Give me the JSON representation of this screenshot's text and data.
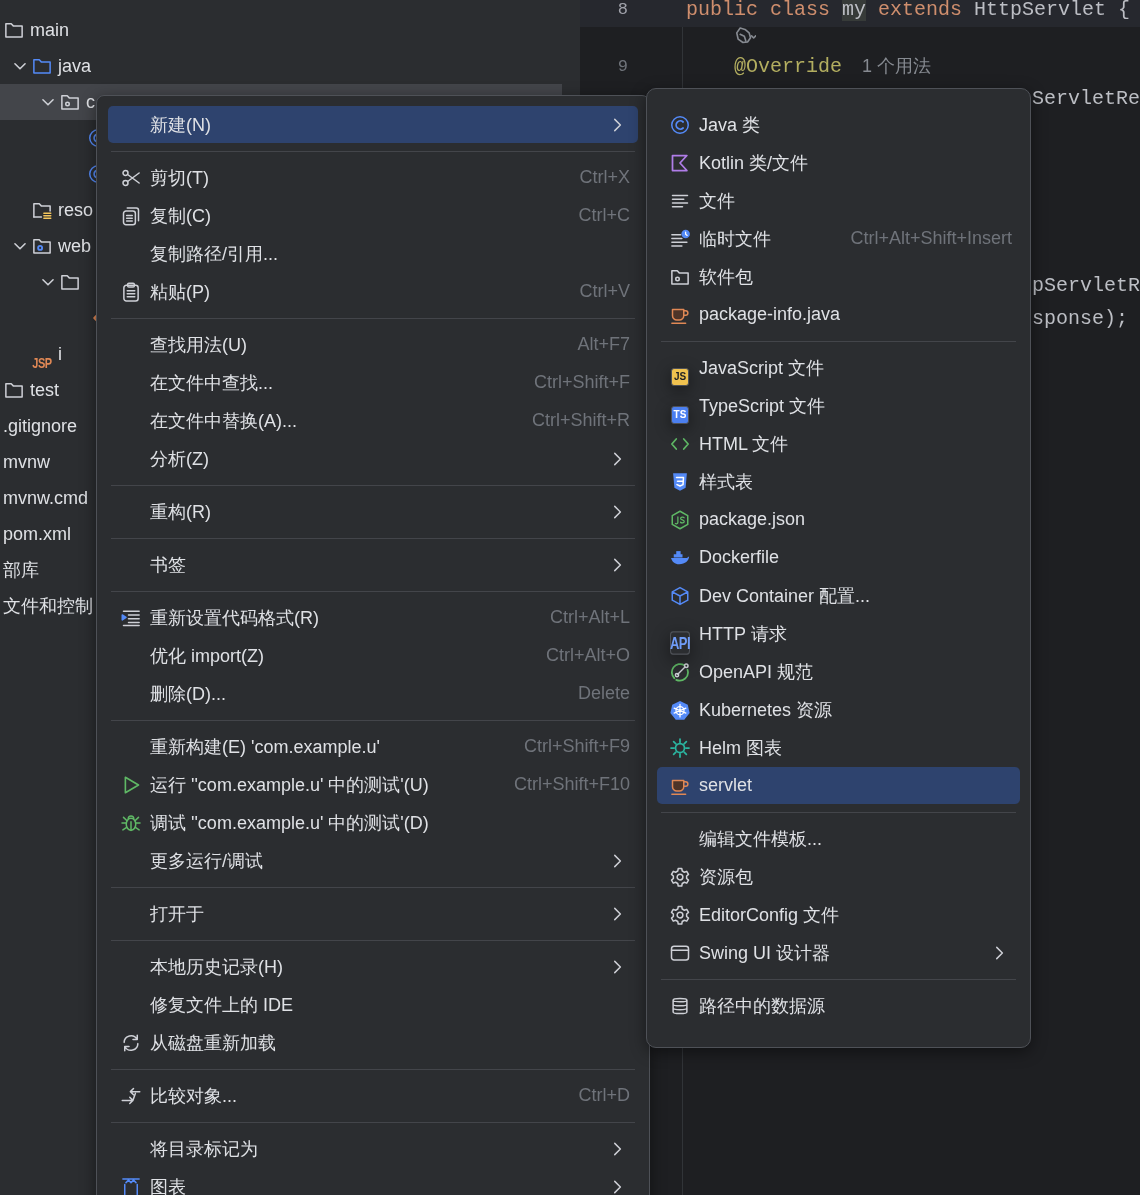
{
  "project_tree": [
    {
      "label": "main",
      "kind": "folder",
      "selected": false,
      "children": [
        {
          "label": "java",
          "kind": "source_folder",
          "expanded": true,
          "selected": false,
          "children": [
            {
              "label": "c",
              "kind": "package",
              "expanded": true,
              "selected": true,
              "children": [
                {
                  "kind": "class",
                  "selected": false
                },
                {
                  "kind": "class",
                  "selected": false
                }
              ]
            }
          ]
        },
        {
          "label": "reso",
          "kind": "resources_folder",
          "selected": false
        },
        {
          "label": "web",
          "kind": "web_folder",
          "expanded": true,
          "selected": false,
          "children": [
            {
              "kind": "folder",
              "expanded": true,
              "selected": false,
              "children": [
                {
                  "kind": "xml",
                  "selected": false
                }
              ]
            },
            {
              "label": "i",
              "kind": "badge",
              "badge": "JSP",
              "selected": false
            }
          ]
        }
      ]
    },
    {
      "label": "test",
      "kind": "folder",
      "selected": false
    },
    {
      "label": ".gitignore",
      "kind": "file",
      "selected": false
    },
    {
      "label": "mvnw",
      "kind": "file",
      "selected": false
    },
    {
      "label": "mvnw.cmd",
      "kind": "file",
      "selected": false
    },
    {
      "label": "pom.xml",
      "kind": "file",
      "selected": false
    },
    {
      "label": "部库",
      "kind": "file",
      "selected": false
    },
    {
      "label": "文件和控制",
      "kind": "file",
      "selected": false
    }
  ],
  "editor": {
    "lines": [
      {
        "kind": "code",
        "number": "8",
        "current": true,
        "tokens": [
          {
            "kind": "keyword",
            "text": "public class "
          },
          {
            "kind": "highlight",
            "text": "my"
          },
          {
            "kind": "keyword",
            "text": " extends "
          },
          {
            "kind": "plain",
            "text": "HttpServlet {"
          }
        ]
      },
      {
        "kind": "inlay"
      },
      {
        "kind": "code",
        "number": "9",
        "current": false,
        "tokens": [
          {
            "kind": "annotation",
            "text": "    @Override"
          },
          {
            "kind": "hint",
            "text": "1 个用法"
          }
        ]
      },
      {
        "kind": "fragment",
        "text": "ServletRe"
      },
      {
        "kind": "fragment",
        "text": "pServletR"
      },
      {
        "kind": "fragment",
        "text": "sponse);"
      }
    ]
  },
  "context_menu": {
    "items": [
      {
        "kind": "plain",
        "label": "新建(N)",
        "has_submenu": true,
        "selected": true
      },
      {
        "kind": "separator"
      },
      {
        "kind": "scissors",
        "label": "剪切(T)",
        "shortcut": "Ctrl+X",
        "has_submenu": false,
        "selected": false
      },
      {
        "kind": "copy",
        "label": "复制(C)",
        "shortcut": "Ctrl+C",
        "has_submenu": false,
        "selected": false
      },
      {
        "kind": "plain",
        "label": "复制路径/引用...",
        "has_submenu": false,
        "selected": false
      },
      {
        "kind": "paste",
        "label": "粘贴(P)",
        "shortcut": "Ctrl+V",
        "has_submenu": false,
        "selected": false
      },
      {
        "kind": "separator"
      },
      {
        "kind": "plain",
        "label": "查找用法(U)",
        "shortcut": "Alt+F7",
        "has_submenu": false,
        "selected": false
      },
      {
        "kind": "plain",
        "label": "在文件中查找...",
        "shortcut": "Ctrl+Shift+F",
        "has_submenu": false,
        "selected": false
      },
      {
        "kind": "plain",
        "label": "在文件中替换(A)...",
        "shortcut": "Ctrl+Shift+R",
        "has_submenu": false,
        "selected": false
      },
      {
        "kind": "plain",
        "label": "分析(Z)",
        "has_submenu": true,
        "selected": false
      },
      {
        "kind": "separator"
      },
      {
        "kind": "plain",
        "label": "重构(R)",
        "has_submenu": true,
        "selected": false
      },
      {
        "kind": "separator"
      },
      {
        "kind": "plain",
        "label": "书签",
        "has_submenu": true,
        "selected": false
      },
      {
        "kind": "separator"
      },
      {
        "kind": "format",
        "label": "重新设置代码格式(R)",
        "shortcut": "Ctrl+Alt+L",
        "has_submenu": false,
        "selected": false
      },
      {
        "kind": "plain",
        "label": "优化 import(Z)",
        "shortcut": "Ctrl+Alt+O",
        "has_submenu": false,
        "selected": false
      },
      {
        "kind": "plain",
        "label": "删除(D)...",
        "shortcut": "Delete",
        "has_submenu": false,
        "selected": false
      },
      {
        "kind": "separator"
      },
      {
        "kind": "plain",
        "label": "重新构建(E) 'com.example.u'",
        "shortcut": "Ctrl+Shift+F9",
        "has_submenu": false,
        "selected": false
      },
      {
        "kind": "play",
        "label": "运行 ''com.example.u' 中的测试'(U)",
        "shortcut": "Ctrl+Shift+F10",
        "has_submenu": false,
        "selected": false
      },
      {
        "kind": "bug",
        "label": "调试 ''com.example.u' 中的测试'(D)",
        "has_submenu": false,
        "selected": false
      },
      {
        "kind": "plain",
        "label": "更多运行/调试",
        "has_submenu": true,
        "selected": false
      },
      {
        "kind": "separator"
      },
      {
        "kind": "plain",
        "label": "打开于",
        "has_submenu": true,
        "selected": false
      },
      {
        "kind": "separator"
      },
      {
        "kind": "plain",
        "label": "本地历史记录(H)",
        "has_submenu": true,
        "selected": false
      },
      {
        "kind": "plain",
        "label": "修复文件上的 IDE",
        "has_submenu": false,
        "selected": false
      },
      {
        "kind": "reload",
        "label": "从磁盘重新加载",
        "has_submenu": false,
        "selected": false
      },
      {
        "kind": "separator"
      },
      {
        "kind": "compare",
        "label": "比较对象...",
        "shortcut": "Ctrl+D",
        "has_submenu": false,
        "selected": false
      },
      {
        "kind": "separator"
      },
      {
        "kind": "plain",
        "label": "将目录标记为",
        "has_submenu": true,
        "selected": false
      },
      {
        "kind": "diagram",
        "label": "图表",
        "has_submenu": true,
        "selected": false
      }
    ]
  },
  "submenu": {
    "items": [
      {
        "kind": "class",
        "label": "Java 类",
        "has_submenu": false,
        "selected": false
      },
      {
        "kind": "kotlin",
        "label": "Kotlin 类/文件",
        "has_submenu": false,
        "selected": false
      },
      {
        "kind": "text_file",
        "label": "文件",
        "has_submenu": false,
        "selected": false
      },
      {
        "kind": "scratch_file",
        "label": "临时文件",
        "shortcut": "Ctrl+Alt+Shift+Insert",
        "has_submenu": false,
        "selected": false
      },
      {
        "kind": "package",
        "label": "软件包",
        "has_submenu": false,
        "selected": false
      },
      {
        "kind": "cup",
        "label": "package-info.java",
        "has_submenu": false,
        "selected": false
      },
      {
        "kind": "separator"
      },
      {
        "kind": "badge",
        "badge": "JS",
        "label": "JavaScript 文件",
        "has_submenu": false,
        "selected": false
      },
      {
        "kind": "badge",
        "badge": "TS",
        "label": "TypeScript 文件",
        "has_submenu": false,
        "selected": false
      },
      {
        "kind": "code_brackets",
        "label": "HTML 文件",
        "has_submenu": false,
        "selected": false
      },
      {
        "kind": "css",
        "label": "样式表",
        "has_submenu": false,
        "selected": false
      },
      {
        "kind": "hexagon",
        "label": "package.json",
        "has_submenu": false,
        "selected": false
      },
      {
        "kind": "whale",
        "label": "Dockerfile",
        "has_submenu": false,
        "selected": false
      },
      {
        "kind": "cube",
        "label": "Dev Container 配置...",
        "has_submenu": false,
        "selected": false
      },
      {
        "kind": "badge",
        "badge": "API",
        "label": "HTTP 请求",
        "has_submenu": false,
        "selected": false
      },
      {
        "kind": "gauge",
        "label": "OpenAPI 规范",
        "has_submenu": false,
        "selected": false
      },
      {
        "kind": "wheel",
        "label": "Kubernetes 资源",
        "has_submenu": false,
        "selected": false
      },
      {
        "kind": "sun",
        "label": "Helm 图表",
        "has_submenu": false,
        "selected": false
      },
      {
        "kind": "cup",
        "label": "servlet",
        "has_submenu": false,
        "selected": true
      },
      {
        "kind": "separator"
      },
      {
        "kind": "plain",
        "label": "编辑文件模板...",
        "has_submenu": false,
        "selected": false
      },
      {
        "kind": "gear",
        "label": "资源包",
        "has_submenu": false,
        "selected": false
      },
      {
        "kind": "gear",
        "label": "EditorConfig 文件",
        "has_submenu": false,
        "selected": false
      },
      {
        "kind": "window",
        "label": "Swing UI 设计器",
        "has_submenu": true,
        "selected": false
      },
      {
        "kind": "separator"
      },
      {
        "kind": "database",
        "label": "路径中的数据源",
        "has_submenu": false,
        "selected": false
      }
    ]
  }
}
